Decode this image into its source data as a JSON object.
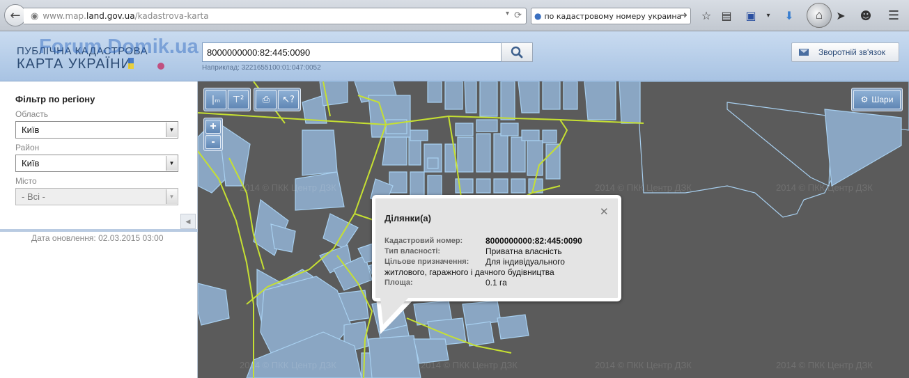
{
  "browser": {
    "url_host": "www.map.",
    "url_domain": "land.gov.ua",
    "url_path": "/kadastrova-karta",
    "search_text": "по кадастровому номеру украина"
  },
  "header": {
    "logo_line1": "ПУБЛІЧНА КАДАСТРОВА",
    "logo_line2": "КАРТА УКРАЇНИ",
    "watermark": "Forum.Domik.ua",
    "cadastral_input_value": "8000000000:82:445:0090",
    "hint": "Наприклад: 3221655100:01:047:0052",
    "feedback_label": "Зворотній зв'язок"
  },
  "sidebar": {
    "filter_title": "Фільтр по регіону",
    "region_label": "Область",
    "region_value": "Київ",
    "district_label": "Район",
    "district_value": "Київ",
    "city_label": "Місто",
    "city_value": "- Всі -",
    "update_date": "Дата оновлення: 02.03.2015 03:00"
  },
  "map": {
    "layers_label": "Шари",
    "zoom_in": "+",
    "zoom_out": "-",
    "copyright": "2014 © ПКК  Центр ДЗК"
  },
  "popup": {
    "title": "Ділянки(а)",
    "cadastral_label": "Кадастровий номер:",
    "cadastral_value": "8000000000:82:445:0090",
    "ownership_label": "Тип власності:",
    "ownership_value": "Приватна власність",
    "purpose_label": "Цільове призначення:",
    "purpose_value": "Для індивідуального",
    "purpose_value_cont": "житлового, гаражного і дачного будівництва",
    "area_label": "Площа:",
    "area_value": "0.1 га"
  },
  "colors": {
    "header_bg": "#b6cde8",
    "map_bg": "#5b5b5b",
    "parcel_fill": "#8aa6c3",
    "parcel_stroke": "#a8d0f0",
    "boundary": "#c6e032",
    "popup_bg": "#e4e4e4"
  }
}
